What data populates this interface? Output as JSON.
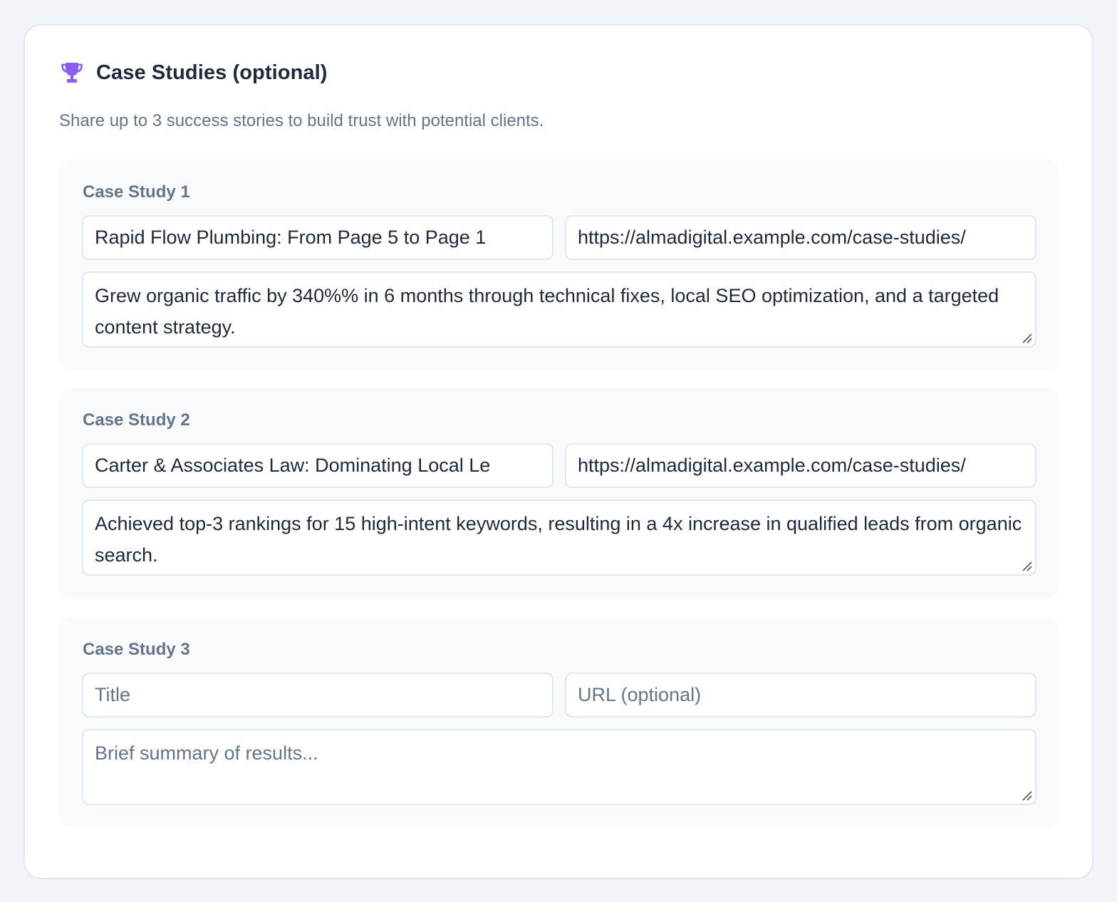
{
  "section": {
    "icon": "trophy-icon",
    "title": "Case Studies (optional)",
    "subtitle": "Share up to 3 success stories to build trust with potential clients.",
    "accent_color": "#8b5cf6"
  },
  "case_studies": [
    {
      "label": "Case Study 1",
      "title_value": "Rapid Flow Plumbing: From Page 5 to Page 1",
      "title_placeholder": "Title",
      "url_value": "https://almadigital.example.com/case-studies/",
      "url_placeholder": "URL (optional)",
      "summary_value": "Grew organic traffic by 340%% in 6 months through technical fixes, local SEO optimization, and a targeted content strategy.",
      "summary_placeholder": "Brief summary of results..."
    },
    {
      "label": "Case Study 2",
      "title_value": "Carter & Associates Law: Dominating Local Le",
      "title_placeholder": "Title",
      "url_value": "https://almadigital.example.com/case-studies/",
      "url_placeholder": "URL (optional)",
      "summary_value": "Achieved top-3 rankings for 15 high-intent keywords, resulting in a 4x increase in qualified leads from organic search.",
      "summary_placeholder": "Brief summary of results..."
    },
    {
      "label": "Case Study 3",
      "title_value": "",
      "title_placeholder": "Title",
      "url_value": "",
      "url_placeholder": "URL (optional)",
      "summary_value": "",
      "summary_placeholder": "Brief summary of results..."
    }
  ]
}
